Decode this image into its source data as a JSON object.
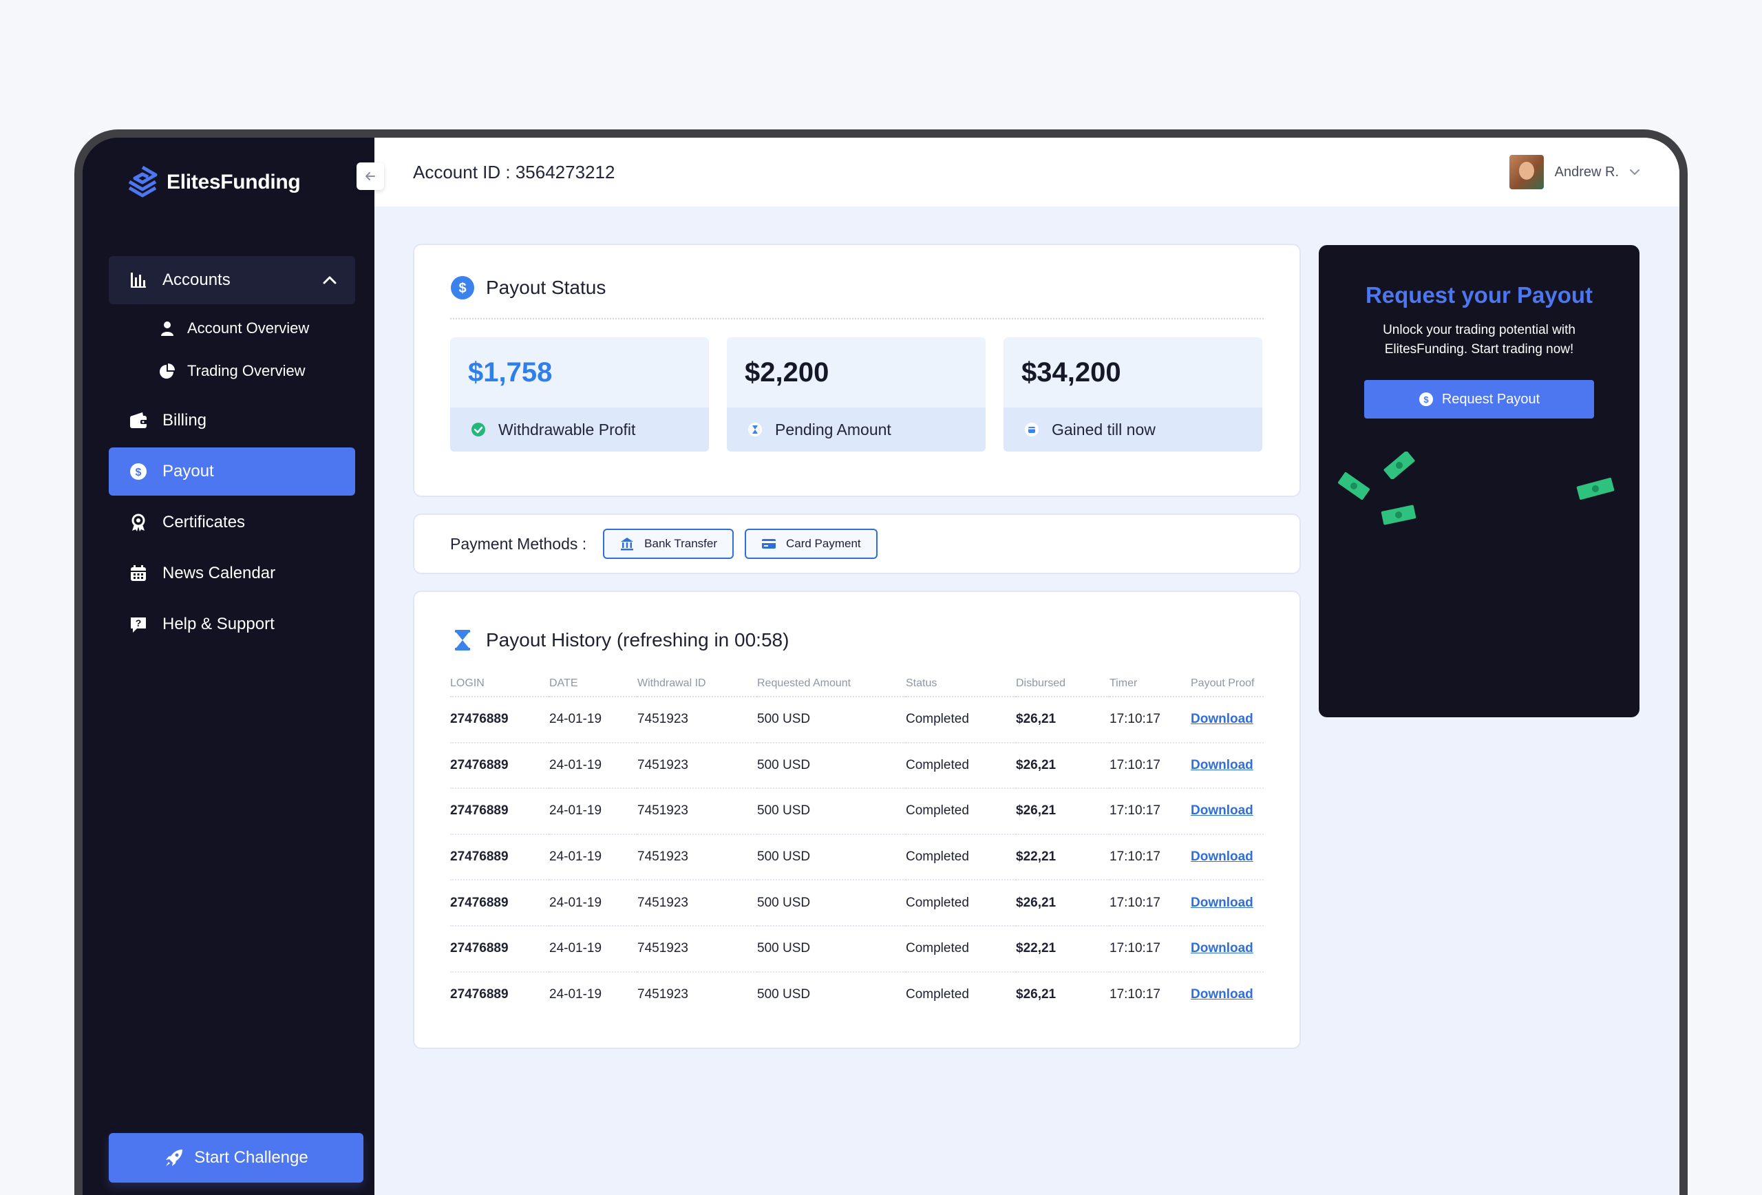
{
  "brand": {
    "name": "ElitesFunding"
  },
  "sidebar": {
    "accounts_label": "Accounts",
    "sub_items": [
      {
        "label": "Account Overview",
        "icon": "user-icon"
      },
      {
        "label": "Trading Overview",
        "icon": "pie-chart-icon"
      }
    ],
    "items": [
      {
        "label": "Billing",
        "icon": "wallet-icon"
      },
      {
        "label": "Payout",
        "icon": "dollar-circle-icon",
        "active": true
      },
      {
        "label": "Certificates",
        "icon": "award-icon"
      },
      {
        "label": "News Calendar",
        "icon": "calendar-icon"
      },
      {
        "label": "Help & Support",
        "icon": "help-chat-icon"
      }
    ],
    "start_challenge": "Start Challenge"
  },
  "header": {
    "account_id": "Account ID : 3564273212",
    "user_name": "Andrew R."
  },
  "payout_status": {
    "title": "Payout Status",
    "stats": [
      {
        "value": "$1,758",
        "label": "Withdrawable Profit",
        "icon": "check-circle-icon"
      },
      {
        "value": "$2,200",
        "label": "Pending Amount",
        "icon": "hourglass-icon"
      },
      {
        "value": "$34,200",
        "label": "Gained till now",
        "icon": "wallet-icon"
      }
    ]
  },
  "payment_methods": {
    "label": "Payment Methods :",
    "options": [
      "Bank Transfer",
      "Card Payment"
    ]
  },
  "history": {
    "title": "Payout History (refreshing in 00:58)",
    "columns": [
      "LOGIN",
      "DATE",
      "Withdrawal ID",
      "Requested Amount",
      "Status",
      "Disbursed",
      "Timer",
      "Payout Proof"
    ],
    "rows": [
      [
        "27476889",
        "24-01-19",
        "7451923",
        "500 USD",
        "Completed",
        "$26,21",
        "17:10:17",
        "Download"
      ],
      [
        "27476889",
        "24-01-19",
        "7451923",
        "500 USD",
        "Completed",
        "$26,21",
        "17:10:17",
        "Download"
      ],
      [
        "27476889",
        "24-01-19",
        "7451923",
        "500 USD",
        "Completed",
        "$26,21",
        "17:10:17",
        "Download"
      ],
      [
        "27476889",
        "24-01-19",
        "7451923",
        "500 USD",
        "Completed",
        "$22,21",
        "17:10:17",
        "Download"
      ],
      [
        "27476889",
        "24-01-19",
        "7451923",
        "500 USD",
        "Completed",
        "$26,21",
        "17:10:17",
        "Download"
      ],
      [
        "27476889",
        "24-01-19",
        "7451923",
        "500 USD",
        "Completed",
        "$22,21",
        "17:10:17",
        "Download"
      ],
      [
        "27476889",
        "24-01-19",
        "7451923",
        "500 USD",
        "Completed",
        "$26,21",
        "17:10:17",
        "Download"
      ]
    ]
  },
  "request_payout": {
    "title": "Request your Payout",
    "subtitle_line1": "Unlock your trading potential with",
    "subtitle_line2": "ElitesFunding. Start trading now!",
    "button": "Request Payout"
  },
  "colors": {
    "accent": "#4d76f1",
    "sidebar_bg": "#131222",
    "success": "#25b67a",
    "link": "#2f6fd8"
  }
}
